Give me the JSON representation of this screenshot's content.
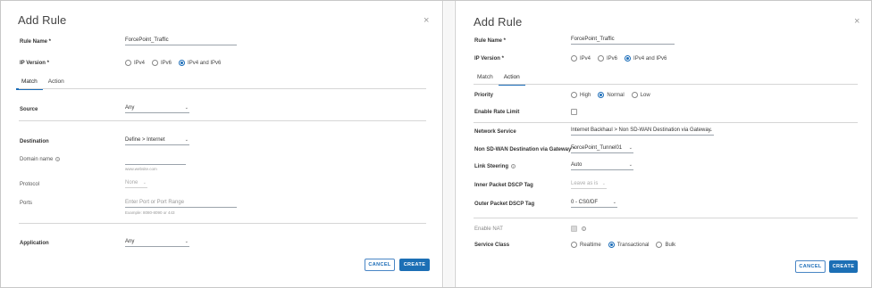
{
  "left": {
    "title": "Add Rule",
    "close_glyph": "×",
    "rule_name_label": "Rule Name *",
    "rule_name_value": "ForcePoint_Traffic",
    "ip_version_label": "IP Version *",
    "ip_options": [
      "IPv4",
      "IPv6",
      "IPv4 and IPv6"
    ],
    "ip_selected": "IPv4 and IPv6",
    "tabs": [
      "Match",
      "Action"
    ],
    "active_tab": "Match",
    "source_label": "Source",
    "source_value": "Any",
    "destination_label": "Destination",
    "destination_value": "Define > Internet",
    "domain_name_label": "Domain name",
    "domain_name_hint": "www.website.com",
    "protocol_label": "Protocol",
    "protocol_value": "None",
    "ports_label": "Ports",
    "ports_placeholder": "Enter Port or Port Range",
    "ports_hint": "Example: 8080-8090 or 443",
    "application_label": "Application",
    "application_value": "Any",
    "cancel_label": "CANCEL",
    "create_label": "CREATE"
  },
  "right": {
    "title": "Add Rule",
    "close_glyph": "×",
    "rule_name_label": "Rule Name *",
    "rule_name_value": "ForcePoint_Traffic",
    "ip_version_label": "IP Version *",
    "ip_options": [
      "IPv4",
      "IPv6",
      "IPv4 and IPv6"
    ],
    "ip_selected": "IPv4 and IPv6",
    "tabs": [
      "Match",
      "Action"
    ],
    "active_tab": "Action",
    "priority_label": "Priority",
    "priority_options": [
      "High",
      "Normal",
      "Low"
    ],
    "priority_selected": "Normal",
    "enable_rate_limit_label": "Enable Rate Limit",
    "network_service_label": "Network Service",
    "network_service_value": "Internet Backhaul > Non SD-WAN Destination via Gateway",
    "nsd_gateway_label": "Non SD-WAN Destination via Gateway *",
    "nsd_gateway_value": "ForcePoint_Tunnel01",
    "link_steering_label": "Link Steering",
    "link_steering_value": "Auto",
    "inner_dscp_label": "Inner Packet DSCP Tag",
    "inner_dscp_value": "Leave as is",
    "outer_dscp_label": "Outer Packet DSCP Tag",
    "outer_dscp_value": "0 - CS0/DF",
    "enable_nat_label": "Enable NAT",
    "service_class_label": "Service Class",
    "service_class_options": [
      "Realtime",
      "Transactional",
      "Bulk"
    ],
    "service_class_selected": "Transactional",
    "cancel_label": "CANCEL",
    "create_label": "CREATE"
  },
  "colors": {
    "accent": "#1c6fb5",
    "border": "#d6d6d6"
  },
  "icons": {
    "close": "close-icon",
    "info": "info-icon",
    "dropdown": "chevron-down-icon"
  }
}
